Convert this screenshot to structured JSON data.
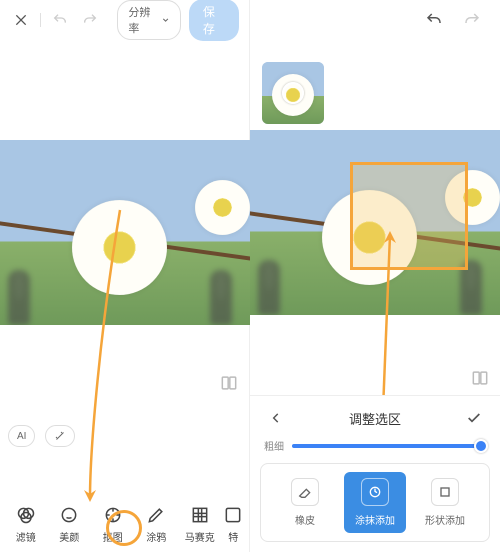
{
  "left": {
    "topbar": {
      "resolution_label": "分辨率",
      "save_label": "保存"
    },
    "ai_label": "AI",
    "tools": [
      {
        "label": "滤镜"
      },
      {
        "label": "美颜"
      },
      {
        "label": "抠图"
      },
      {
        "label": "涂鸦"
      },
      {
        "label": "马赛克"
      },
      {
        "label": "特"
      }
    ]
  },
  "right": {
    "panel_title": "调整选区",
    "slider_label": "粗细",
    "modes": [
      {
        "label": "橡皮"
      },
      {
        "label": "涂抹添加"
      },
      {
        "label": "形状添加"
      }
    ]
  },
  "colors": {
    "annotation": "#f5a53a",
    "primary": "#3b8de3"
  }
}
